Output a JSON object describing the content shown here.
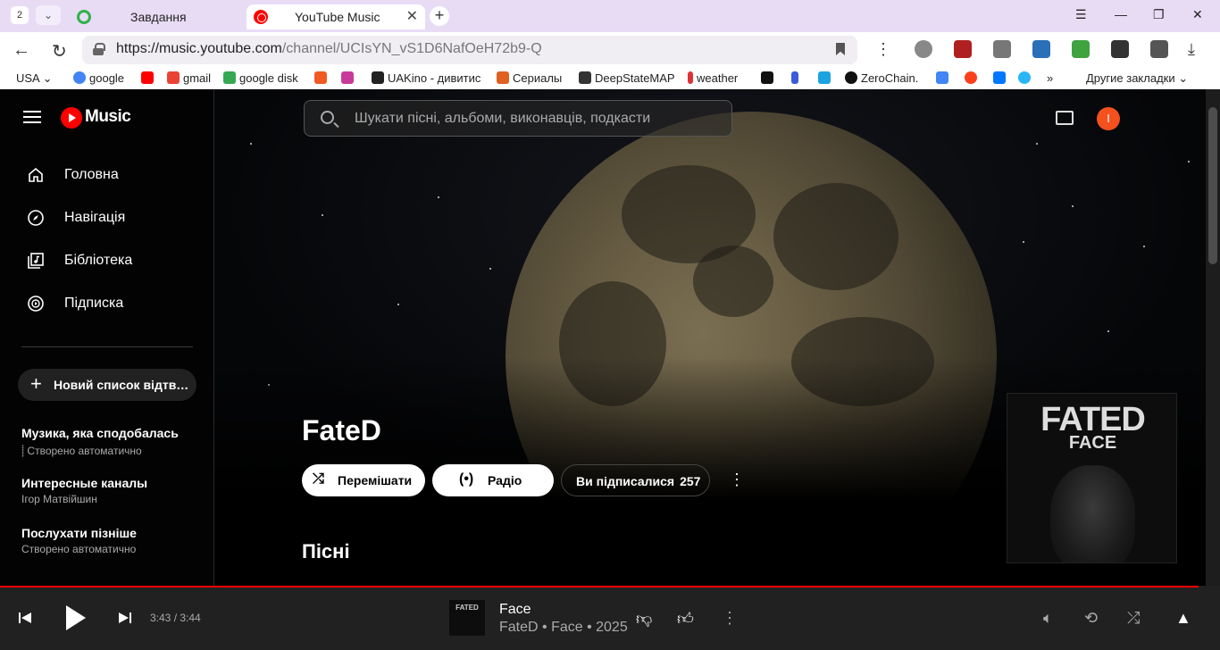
{
  "browser": {
    "tab_count": "2",
    "tabs": [
      {
        "label": "Завдання"
      },
      {
        "label": "YouTube Music"
      }
    ],
    "url_domain": "https://music.youtube.com",
    "url_path": "/channel/UCIsYN_vS1D6NafOeH72b9-Q",
    "bookmarks": [
      "USA",
      "google",
      "gmail",
      "google disk",
      "UAKino - дивитис",
      "Сериалы",
      "DeepStateMAP",
      "weather",
      "ZeroChain.",
      "Другие закладки"
    ]
  },
  "sidebar": {
    "logo": "Music",
    "nav": [
      {
        "label": "Головна",
        "icon": "home-icon"
      },
      {
        "label": "Навігація",
        "icon": "compass-icon"
      },
      {
        "label": "Бібліотека",
        "icon": "library-icon"
      },
      {
        "label": "Підписка",
        "icon": "subscription-icon"
      }
    ],
    "new_playlist": "Новий список відтв…",
    "playlists": [
      {
        "title": "Музика, яка сподобалась",
        "sub": "Створено автоматично"
      },
      {
        "title": "Интересные каналы",
        "sub": "Ігор Матвійшин"
      },
      {
        "title": "Послухати пізніше",
        "sub": "Створено автоматично"
      }
    ]
  },
  "header": {
    "search_placeholder": "Шукати пісні, альбоми, виконавців, подкасти",
    "avatar_letter": "I"
  },
  "artist": {
    "name": "FateD",
    "shuffle_label": "Перемішати",
    "radio_label": "Радіо",
    "subscribed_label": "Ви підписалися",
    "subscriber_count": "257",
    "section_title": "Пісні",
    "cover_line1": "FATED",
    "cover_line2": "FACE"
  },
  "player": {
    "time": "3:43 / 3:44",
    "progress": 0.995,
    "song_title": "Face",
    "song_sub": "FateD • Face • 2025",
    "thumb_text": "FATED"
  },
  "colors": {
    "accent": "#ff0000",
    "avatar": "#f4511e"
  }
}
